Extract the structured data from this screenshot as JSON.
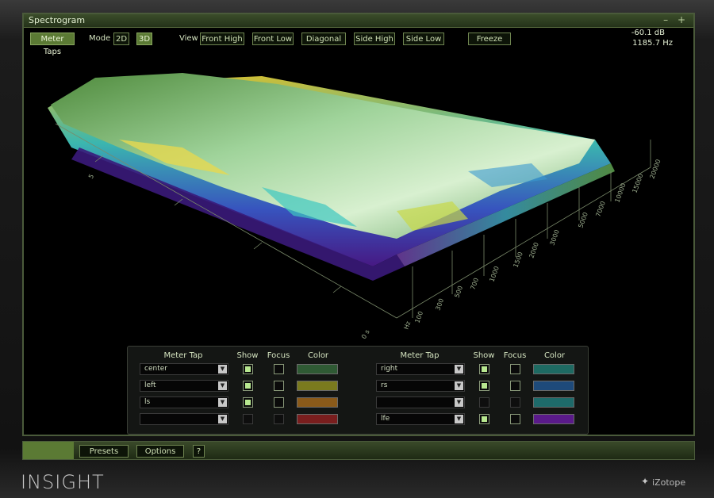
{
  "window": {
    "title": "Spectrogram",
    "controls": "– +"
  },
  "toolbar": {
    "meter_taps": "Meter Taps",
    "mode_label": "Mode",
    "mode_2d": "2D",
    "mode_3d": "3D",
    "view_label": "View",
    "front_high": "Front High",
    "front_low": "Front Low",
    "diagonal": "Diagonal",
    "side_high": "Side High",
    "side_low": "Side Low",
    "freeze": "Freeze"
  },
  "readout": {
    "db": "-60.1 dB",
    "hz": "1185.7 Hz"
  },
  "axis": {
    "time_labels": [
      "5",
      "0 s"
    ],
    "freq_labels": [
      "Hz",
      "100",
      "300",
      "500",
      "700",
      "1000",
      "1500",
      "2000",
      "3000",
      "5000",
      "7000",
      "10000",
      "15000",
      "20000"
    ]
  },
  "table": {
    "headers": {
      "meter_tap": "Meter Tap",
      "show": "Show",
      "focus": "Focus",
      "color": "Color"
    },
    "left": [
      {
        "tap": "center",
        "show": true,
        "focus": false,
        "color": "#2f5a34",
        "enabled": true
      },
      {
        "tap": "left",
        "show": true,
        "focus": false,
        "color": "#7a7a1e",
        "enabled": true
      },
      {
        "tap": "ls",
        "show": true,
        "focus": false,
        "color": "#8a5a1a",
        "enabled": true
      },
      {
        "tap": "",
        "show": false,
        "focus": false,
        "color": "#7a1e1e",
        "enabled": false
      }
    ],
    "right": [
      {
        "tap": "right",
        "show": true,
        "focus": false,
        "color": "#1e6a62",
        "enabled": true
      },
      {
        "tap": "rs",
        "show": true,
        "focus": false,
        "color": "#1e4a7a",
        "enabled": true
      },
      {
        "tap": "",
        "show": false,
        "focus": false,
        "color": "#1e6a6a",
        "enabled": false
      },
      {
        "tap": "lfe",
        "show": true,
        "focus": false,
        "color": "#5a1a8a",
        "enabled": true
      }
    ]
  },
  "bottom": {
    "presets": "Presets",
    "options": "Options",
    "help": "?"
  },
  "brand": {
    "product": "INSIGHT",
    "company": "iZotope"
  },
  "colors": {
    "accent": "#5b7a34",
    "border": "#6e8450"
  }
}
